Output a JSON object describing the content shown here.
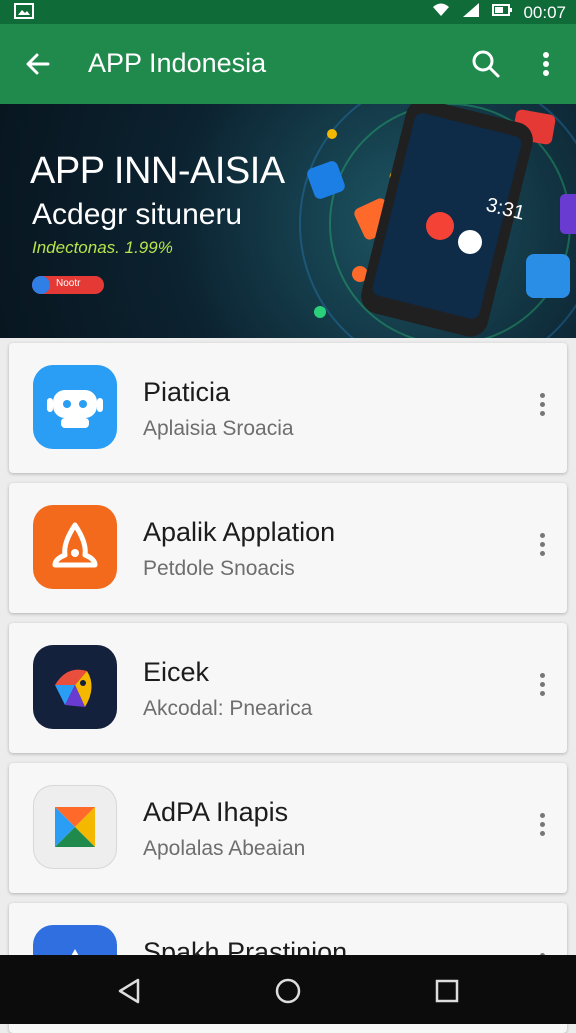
{
  "status_bar": {
    "time": "00:07"
  },
  "app_bar": {
    "title": "APP Indonesia"
  },
  "banner": {
    "headline": "APP INN-AISIA",
    "subheadline": "Acdegr situneru",
    "tagline": "Indectonas. 1.99%",
    "button_label": "Nootr"
  },
  "apps": [
    {
      "name": "Piaticia",
      "subtitle": "Aplaisia Sroacia",
      "icon": "robot-icon",
      "color": "#2a9df4"
    },
    {
      "name": "Apalik Applation",
      "subtitle": "Petdole Snoacis",
      "icon": "flame-icon",
      "color": "#f36a1d"
    },
    {
      "name": "Eicek",
      "subtitle": "Akcodal: Pnearica",
      "icon": "bird-icon",
      "color": "#14213d"
    },
    {
      "name": "AdPA Ihapis",
      "subtitle": "Apolalas Abeaian",
      "icon": "play-tile-icon",
      "color": "#eeeeee"
    },
    {
      "name": "Spakh Prastinion",
      "subtitle": "",
      "icon": "app-icon",
      "color": "#2f6fe0"
    }
  ]
}
